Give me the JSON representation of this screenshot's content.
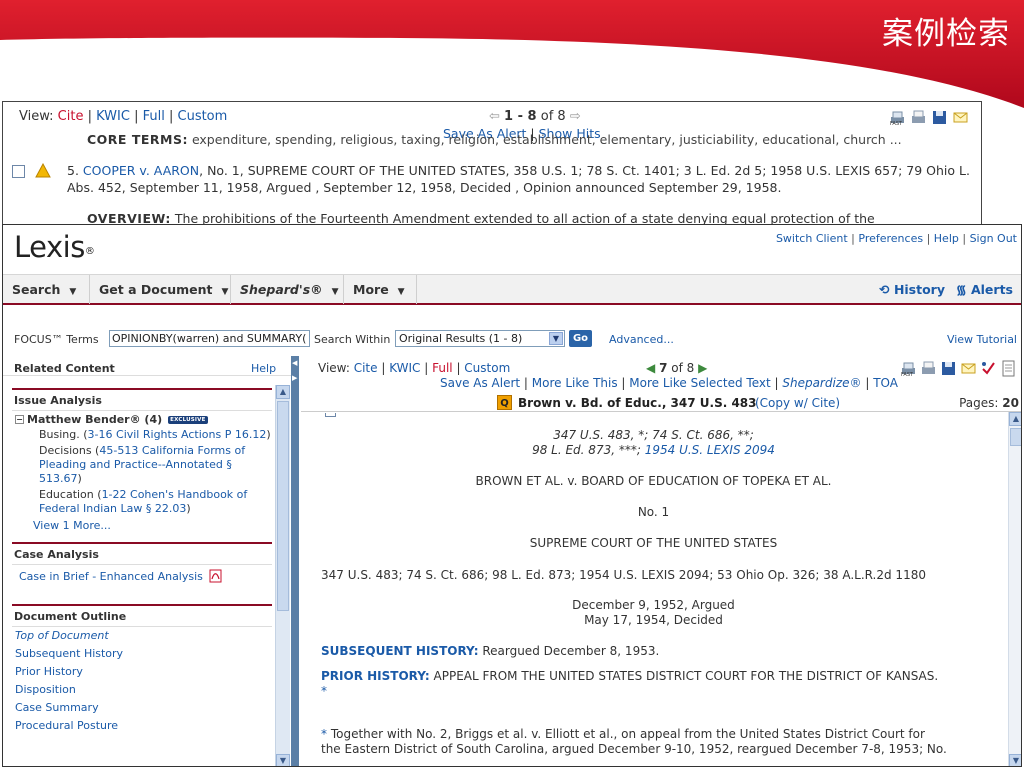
{
  "slide": {
    "title": "案例检索"
  },
  "bg_results": {
    "view_label": "View:",
    "view_options": [
      "Cite",
      "KWIC",
      "Full",
      "Custom"
    ],
    "nav_range": "1 - 8",
    "nav_of": "of 8",
    "save_alert": "Save As Alert",
    "show_hits": "Show Hits",
    "core_terms_label": "CORE TERMS:",
    "core_terms": "expenditure, spending, religious, taxing, religion, establishment, elementary, justiciability, educational, church ...",
    "result_number": "5.",
    "result_case": "COOPER v. AARON",
    "result_citation": ", No. 1, SUPREME COURT OF THE UNITED STATES, 358 U.S. 1; 78 S. Ct. 1401; 3 L. Ed. 2d 5; 1958 U.S. LEXIS 657; 79 Ohio L. Abs. 452, September 11, 1958, Argued , September 12, 1958, Decided , Opinion announced September 29, 1958.",
    "overview_label": "OVERVIEW:",
    "overview_text": "The prohibitions of the Fourteenth Amendment extended to all action of a state denying equal protection of the"
  },
  "lexis": {
    "logo": "Lexis",
    "logo_mark": "®",
    "top_links": [
      "Switch Client",
      "Preferences",
      "Help",
      "Sign Out"
    ],
    "menu": {
      "search": "Search",
      "get_document": "Get a Document",
      "shepards": "Shepard's®",
      "more": "More",
      "history": "History",
      "alerts": "Alerts"
    },
    "focus": {
      "label": "FOCUS™ Terms",
      "value": "OPINIONBY(warren) and SUMMARY(",
      "within_label": "Search Within",
      "within_value": "Original Results (1 - 8)",
      "go": "Go",
      "advanced": "Advanced...",
      "tutorial": "View Tutorial"
    },
    "sidebar": {
      "title": "Related Content",
      "help": "Help",
      "issue_analysis": {
        "title": "Issue Analysis",
        "source": "Matthew Bender® (4)",
        "badge": "EXCLUSIVE",
        "items": [
          {
            "prefix": "Busing. (",
            "link": "3-16 Civil Rights Actions P 16.12",
            "suffix": ")"
          },
          {
            "prefix": "Decisions (",
            "link": "45-513 California Forms of Pleading and Practice--Annotated § 513.67",
            "suffix": ")"
          },
          {
            "prefix": "Education (",
            "link": "1-22 Cohen's Handbook of Federal Indian Law § 22.03",
            "suffix": ")"
          }
        ],
        "more": "View 1 More..."
      },
      "case_analysis": {
        "title": "Case Analysis",
        "link": "Case in Brief - Enhanced Analysis"
      },
      "outline": {
        "title": "Document Outline",
        "items": [
          "Top of Document",
          "Subsequent History",
          "Prior History",
          "Disposition",
          "Case Summary",
          "Procedural Posture"
        ]
      }
    },
    "doc": {
      "view_label": "View:",
      "view_options": [
        "Cite",
        "KWIC",
        "Full",
        "Custom"
      ],
      "nav_current": "7",
      "nav_of": "of 8",
      "links": [
        "Save As Alert",
        "More Like This",
        "More Like Selected Text",
        "Shepardize®",
        "TOA"
      ],
      "q_badge": "Q",
      "case_title": "Brown v. Bd. of Educ., 347 U.S. 483",
      "copy_cite": "(Copy w/ Cite)",
      "pages_label": "Pages:",
      "pages_value": "20",
      "cite_line1": "347 U.S. 483, *; 74 S. Ct. 686, **;",
      "cite_line2_prefix": "98 L. Ed. 873, ***;",
      "cite_line2_link": "1954 U.S. LEXIS 2094",
      "parties": "BROWN ET AL. v. BOARD OF EDUCATION OF TOPEKA ET AL.",
      "docket": "No. 1",
      "court": "SUPREME COURT OF THE UNITED STATES",
      "parallel_cites": "347 U.S. 483; 74 S. Ct. 686; 98 L. Ed. 873; 1954 U.S. LEXIS 2094; 53 Ohio Op. 326; 38 A.L.R.2d 1180",
      "argued": "December 9, 1952, Argued",
      "decided": "May 17, 1954, Decided",
      "subsequent_label": "SUBSEQUENT HISTORY:",
      "subsequent_text": "Reargued December 8, 1953.",
      "prior_label": "PRIOR HISTORY:",
      "prior_text": "APPEAL FROM THE UNITED STATES DISTRICT COURT FOR THE DISTRICT OF KANSAS.",
      "star": "*",
      "footnote_line1": "Together with No. 2, Briggs et al. v. Elliott et al., on appeal from the United States District Court for",
      "footnote_line2": "the Eastern District of South Carolina, argued December 9-10, 1952, reargued December 7-8, 1953; No."
    }
  },
  "colors": {
    "slide_red": "#c8102e",
    "lexis_maroon": "#8a0a24",
    "link_blue": "#1a5aa8"
  }
}
